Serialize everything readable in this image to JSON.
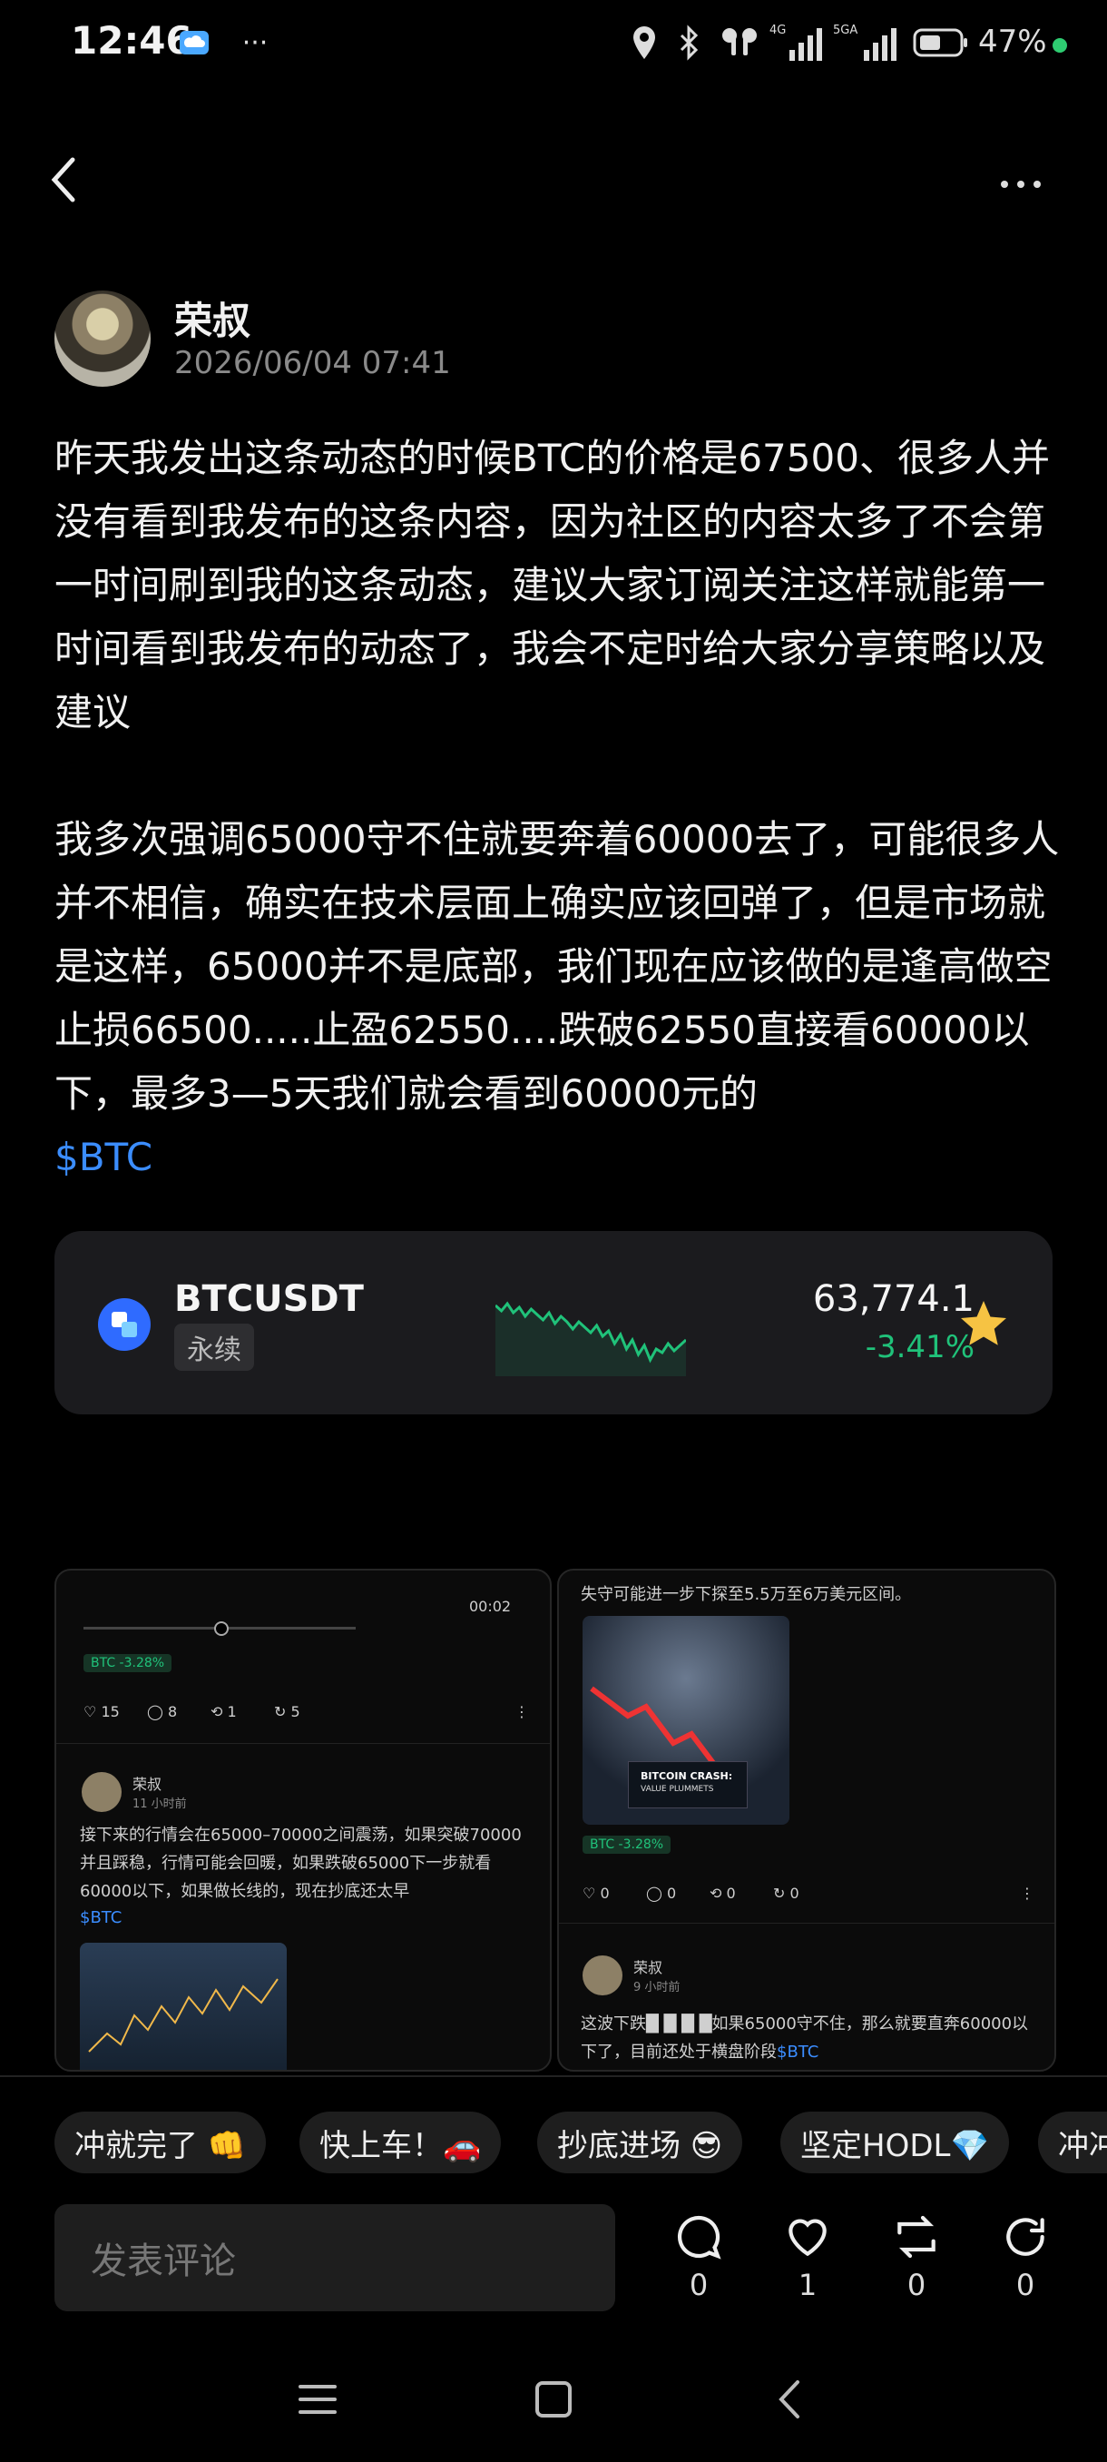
{
  "status_bar": {
    "time": "12:46",
    "battery": "47%",
    "network_4g": "4G",
    "network_5g": "5GA",
    "more": "···"
  },
  "author": {
    "name": "荣叔",
    "date": "2026/06/04 07:41"
  },
  "post": {
    "paragraph1": "昨天我发出这条动态的时候BTC的价格是67500、很多人并没有看到我发布的这条内容，因为社区的内容太多了不会第一时间刷到我的这条动态，建议大家订阅关注这样就能第一时间看到我发布的动态了，我会不定时给大家分享策略以及建议",
    "paragraph2": "我多次强调65000守不住就要奔着60000去了，可能很多人并不相信，确实在技术层面上确实应该回弹了，但是市场就是这样，65000并不是底部，我们现在应该做的是逢高做空止损66500.....止盈62550....跌破62550直接看60000以下，最多3—5天我们就会看到60000元的",
    "tag": "$BTC"
  },
  "ticker": {
    "symbol": "BTCUSDT",
    "badge": "永续",
    "price": "63,774.1",
    "change": "-3.41%",
    "change_color": "#20c27a",
    "favorited": true
  },
  "screenshot_1": {
    "timer": "00:02",
    "badge": "BTC -3.28%",
    "stats": [
      "15",
      "8",
      "1",
      "5"
    ],
    "author": "荣叔",
    "time_ago": "11 小时前",
    "text": "接下来的行情会在65000–70000之间震荡，如果突破70000并且踩稳，行情可能会回暖，如果跌破65000下一步就看60000以下，如果做长线的，现在抄底还太早",
    "tag": "$BTC"
  },
  "screenshot_2": {
    "top_text": "失守可能进一步下探至5.5万至6万美元区间。",
    "image_caption_1": "BITCOIN CRASH:",
    "image_caption_2": "VALUE PLUMMETS",
    "badge": "BTC -3.28%",
    "stats": [
      "0",
      "0",
      "0",
      "0"
    ],
    "author": "荣叔",
    "time_ago": "9 小时前",
    "text": "这波下跌█ █ █ █如果65000守不住，那么就要直奔60000以下了，目前还处于横盘阶段",
    "tag": "$BTC"
  },
  "quick_replies": [
    "冲就完了 👊",
    "快上车！🚗",
    "抄底进场 😎",
    "坚定HODL💎",
    "冲冲"
  ],
  "comment_input": {
    "placeholder": "发表评论"
  },
  "actions": {
    "comments": "0",
    "likes": "1",
    "reposts": "0",
    "shares": "0"
  },
  "sparkline": [
    0.78,
    0.72,
    0.8,
    0.7,
    0.76,
    0.66,
    0.74,
    0.68,
    0.62,
    0.7,
    0.58,
    0.66,
    0.6,
    0.52,
    0.6,
    0.54,
    0.48,
    0.56,
    0.44,
    0.5,
    0.36,
    0.46,
    0.3,
    0.4,
    0.24,
    0.34,
    0.18,
    0.3,
    0.26,
    0.36,
    0.28,
    0.34,
    0.4
  ]
}
